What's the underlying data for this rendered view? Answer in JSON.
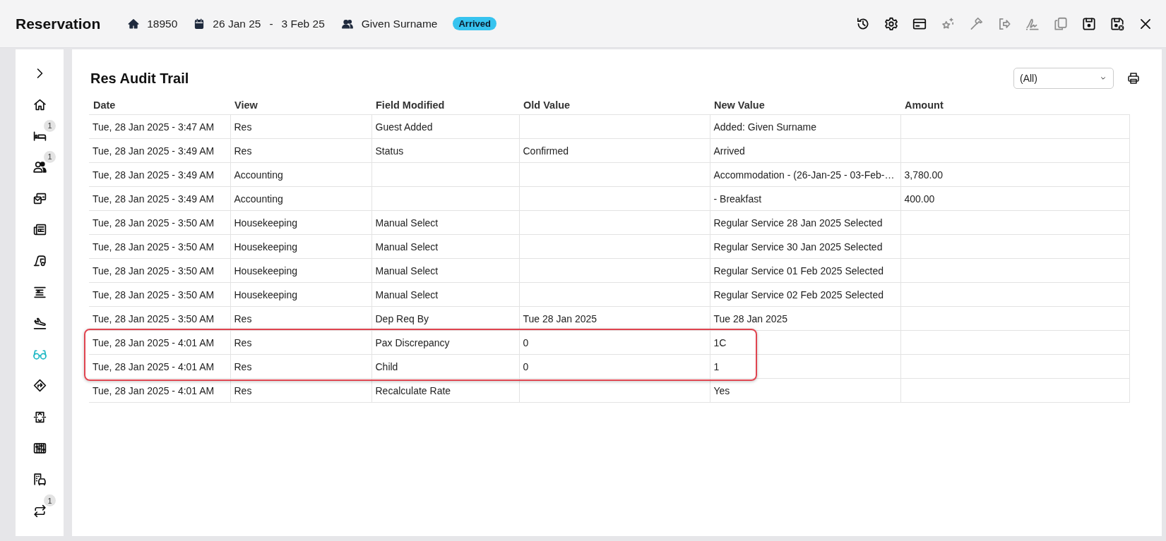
{
  "header": {
    "title": "Reservation",
    "reservation_number": "18950",
    "arrival": "26 Jan 25",
    "date_separator": "-",
    "departure": "3 Feb 25",
    "guest": "Given Surname",
    "status": "Arrived"
  },
  "toolbar": [
    {
      "disabled": false
    },
    {
      "disabled": false
    },
    {
      "disabled": false
    },
    {
      "disabled": true
    },
    {
      "disabled": true
    },
    {
      "disabled": true
    },
    {
      "disabled": true
    },
    {
      "disabled": true
    },
    {
      "disabled": false
    },
    {
      "disabled": false
    },
    {
      "disabled": false
    }
  ],
  "sidebar": {
    "items": [
      {
        "selected": false
      },
      {
        "selected": false,
        "badge": "1"
      },
      {
        "selected": false,
        "badge": "1"
      },
      {
        "selected": false
      },
      {
        "selected": false
      },
      {
        "selected": false
      },
      {
        "selected": false
      },
      {
        "selected": false
      },
      {
        "selected": true
      },
      {
        "selected": false
      },
      {
        "selected": false
      },
      {
        "selected": false
      },
      {
        "selected": false
      },
      {
        "selected": false,
        "badge": "1"
      }
    ]
  },
  "panel": {
    "title": "Res Audit Trail",
    "filter": {
      "value": "(All)"
    },
    "table": {
      "columns": [
        "Date",
        "View",
        "Field Modified",
        "Old Value",
        "New Value",
        "Amount"
      ],
      "rows": [
        {
          "highlighted": false,
          "cells": [
            "Tue, 28 Jan 2025 - 3:47 AM",
            "Res",
            "Guest Added",
            "",
            "Added: Given Surname",
            ""
          ]
        },
        {
          "highlighted": false,
          "cells": [
            "Tue, 28 Jan 2025 - 3:49 AM",
            "Res",
            "Status",
            "Confirmed",
            "Arrived",
            ""
          ]
        },
        {
          "highlighted": false,
          "cells": [
            "Tue, 28 Jan 2025 - 3:49 AM",
            "Accounting",
            "",
            "",
            "Accommodation - (26-Jan-25 - 03-Feb-…",
            "3,780.00"
          ]
        },
        {
          "highlighted": false,
          "cells": [
            "Tue, 28 Jan 2025 - 3:49 AM",
            "Accounting",
            "",
            "",
            "- Breakfast",
            "400.00"
          ]
        },
        {
          "highlighted": false,
          "cells": [
            "Tue, 28 Jan 2025 - 3:50 AM",
            "Housekeeping",
            "Manual Select",
            "",
            "Regular Service 28 Jan 2025 Selected",
            ""
          ]
        },
        {
          "highlighted": false,
          "cells": [
            "Tue, 28 Jan 2025 - 3:50 AM",
            "Housekeeping",
            "Manual Select",
            "",
            "Regular Service 30 Jan 2025 Selected",
            ""
          ]
        },
        {
          "highlighted": false,
          "cells": [
            "Tue, 28 Jan 2025 - 3:50 AM",
            "Housekeeping",
            "Manual Select",
            "",
            "Regular Service 01 Feb 2025 Selected",
            ""
          ]
        },
        {
          "highlighted": false,
          "cells": [
            "Tue, 28 Jan 2025 - 3:50 AM",
            "Housekeeping",
            "Manual Select",
            "",
            "Regular Service 02 Feb 2025 Selected",
            ""
          ]
        },
        {
          "highlighted": false,
          "cells": [
            "Tue, 28 Jan 2025 - 3:50 AM",
            "Res",
            "Dep Req By",
            "Tue 28 Jan 2025",
            "Tue 28 Jan 2025",
            ""
          ]
        },
        {
          "highlighted": true,
          "cells": [
            "Tue, 28 Jan 2025 - 4:01 AM",
            "Res",
            "Pax Discrepancy",
            "0",
            "1C",
            ""
          ]
        },
        {
          "highlighted": true,
          "cells": [
            "Tue, 28 Jan 2025 - 4:01 AM",
            "Res",
            "Child",
            "0",
            "1",
            ""
          ]
        },
        {
          "highlighted": false,
          "cells": [
            "Tue, 28 Jan 2025 - 4:01 AM",
            "Res",
            "Recalculate Rate",
            "",
            "Yes",
            ""
          ]
        }
      ]
    }
  }
}
